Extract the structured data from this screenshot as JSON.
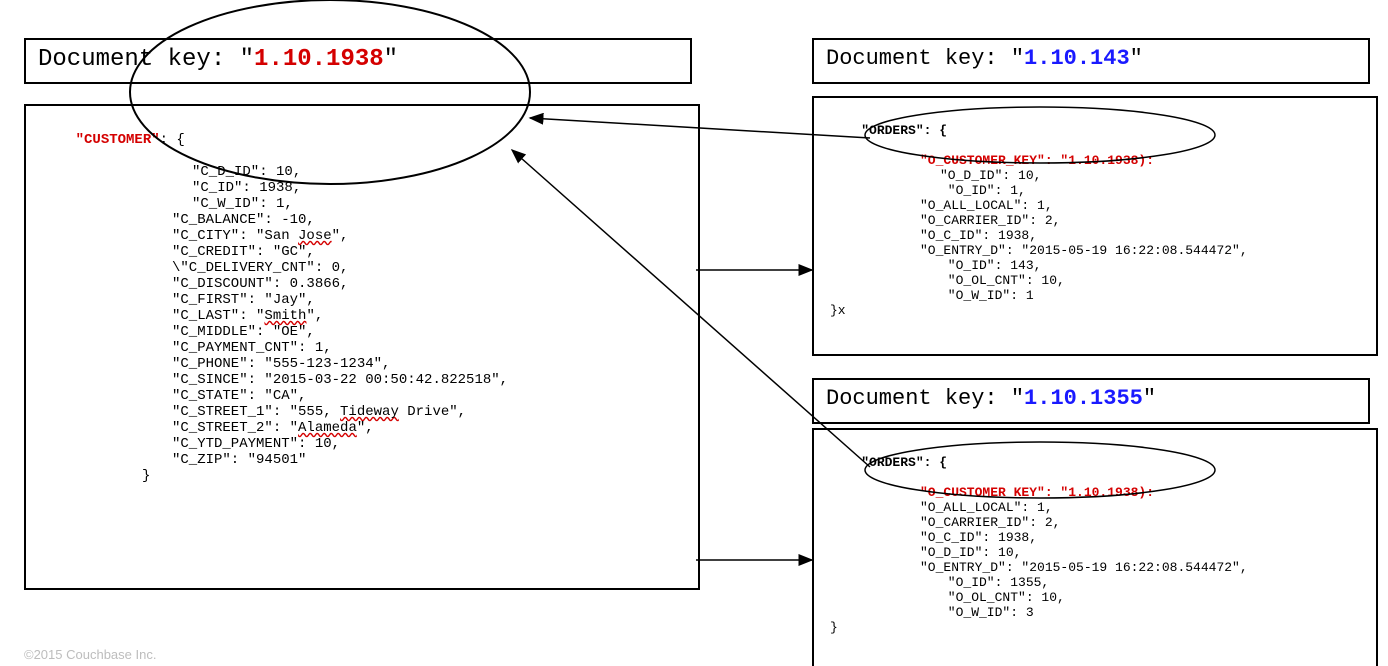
{
  "left": {
    "docKeyLabel": "Document key: ",
    "docKeyQuoteOpen": "\"",
    "docKeyVal": "1.10.1938",
    "docKeyQuoteClose": "\"",
    "headerLabel": "\"CUSTOMER\"",
    "headerSuffix": ": {",
    "fields": [
      "\"C_D_ID\": 10,",
      "\"C_ID\": 1938,",
      "\"C_W_ID\": 1,",
      "\"C_BALANCE\": -10,",
      {
        "pre": "\"C_CITY\": \"San ",
        "sq": "Jose",
        "post": "\","
      },
      "\"C_CREDIT\": \"GC\",",
      "\\\"C_DELIVERY_CNT\": 0,",
      "\"C_DISCOUNT\": 0.3866,",
      "\"C_FIRST\": \"Jay\",",
      {
        "pre": "\"C_LAST\": \"",
        "sq": "Smith",
        "post": "\","
      },
      "\"C_MIDDLE\": \"OE\",",
      "\"C_PAYMENT_CNT\": 1,",
      "\"C_PHONE\": \"555-123-1234\",",
      "\"C_SINCE\": \"2015-03-22 00:50:42.822518\",",
      "\"C_STATE\": \"CA\",",
      {
        "pre": "\"C_STREET_1\": \"555, ",
        "sq": "Tideway",
        "post": " Drive\","
      },
      {
        "pre": "\"C_STREET_2\": \"",
        "sq": "Alameda",
        "post": "\","
      },
      "\"C_YTD_PAYMENT\": 10,",
      "\"C_ZIP\": \"94501\""
    ],
    "closeBrace": "}"
  },
  "orders1": {
    "docKeyLabel": "Document key: ",
    "docKeyQuoteOpen": "\"",
    "docKeyVal": "1.10.143",
    "docKeyQuoteClose": "\"",
    "header": "\"ORDERS\": {",
    "fkLine": "\"O_CUSTOMER_KEY\": \"1.10.1938):",
    "fields": [
      "\"O_D_ID\": 10,",
      " \"O_ID\": 1,",
      "\"O_ALL_LOCAL\": 1,",
      "\"O_CARRIER_ID\": 2,",
      "\"O_C_ID\": 1938,",
      "\"O_ENTRY_D\": \"2015-05-19 16:22:08.544472\",",
      " \"O_ID\": 143,",
      " \"O_OL_CNT\": 10,",
      " \"O_W_ID\": 1"
    ],
    "closeBrace": "}x"
  },
  "orders2": {
    "docKeyLabel": "Document key: ",
    "docKeyQuoteOpen": "\"",
    "docKeyVal": "1.10.1355",
    "docKeyQuoteClose": "\"",
    "header": "\"ORDERS\": {",
    "fkLine": "\"O_CUSTOMER_KEY\": \"1.10.1938):",
    "fields": [
      "\"O_ALL_LOCAL\": 1,",
      "\"O_CARRIER_ID\": 2,",
      "\"O_C_ID\": 1938,",
      "\"O_D_ID\": 10,",
      "\"O_ENTRY_D\": \"2015-05-19 16:22:08.544472\",",
      " \"O_ID\": 1355,",
      " \"O_OL_CNT\": 10,",
      " \"O_W_ID\": 3"
    ],
    "closeBrace": "}"
  },
  "footer": "©2015 Couchbase Inc."
}
